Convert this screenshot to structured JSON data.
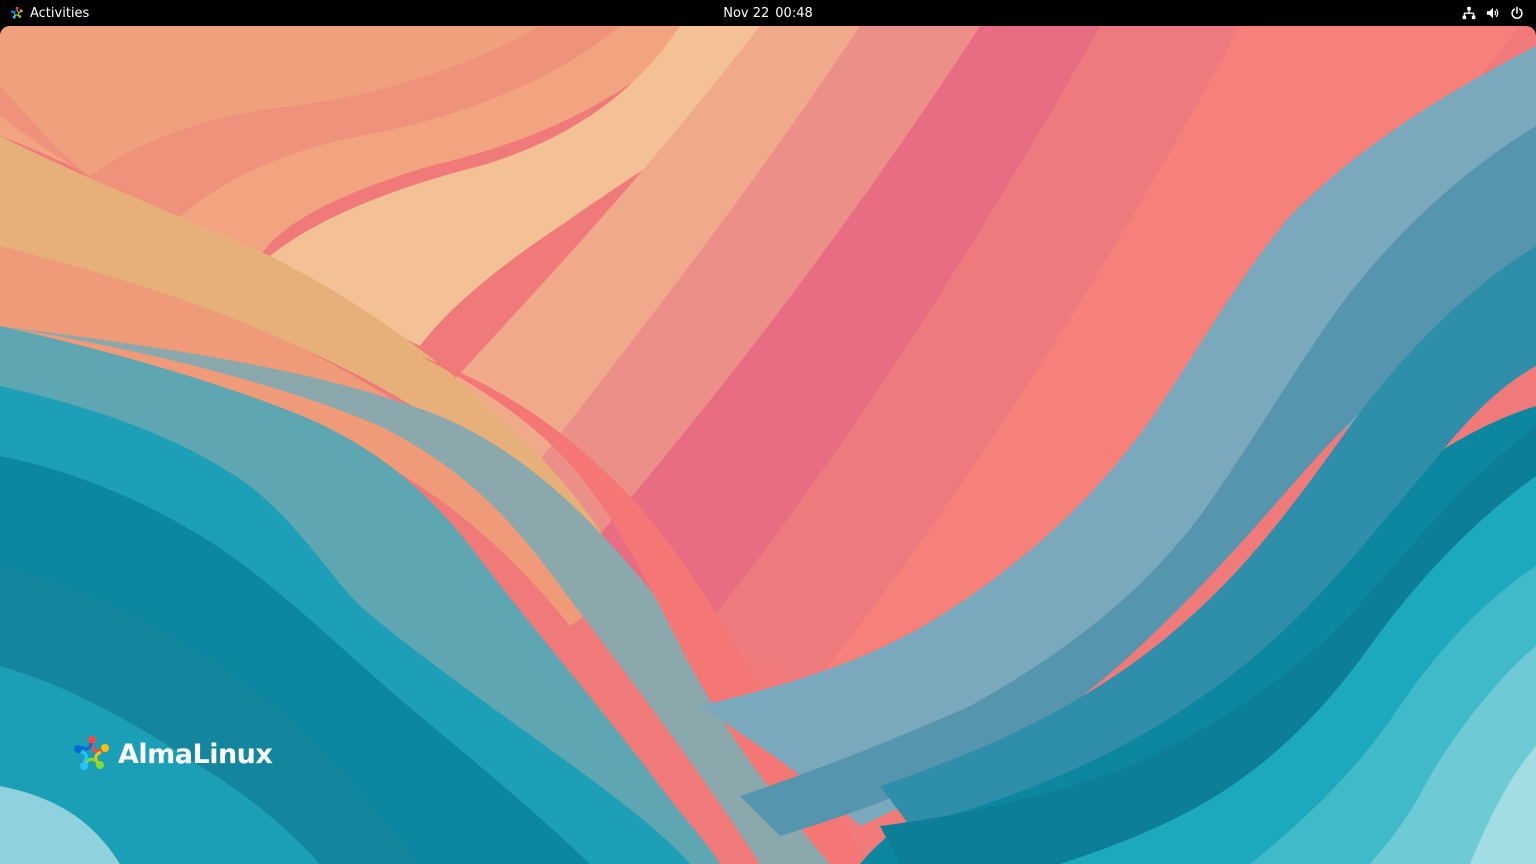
{
  "topbar": {
    "activities_label": "Activities",
    "date": "Nov 22",
    "time": "00:48",
    "tray": {
      "network_icon": "network-wired-icon",
      "volume_icon": "speaker-volume-icon",
      "power_icon": "power-icon"
    }
  },
  "desktop": {
    "brand_text": "AlmaLinux",
    "brand_icon": "almalinux-logo-icon",
    "colors": {
      "peach": "#f4b689",
      "salmon": "#ef8b7c",
      "coral": "#f47a78",
      "rose": "#e66a82",
      "slate": "#8aa8ae",
      "teal_dark": "#0b8199",
      "teal": "#1ea5bd",
      "aqua": "#6fcfda"
    }
  }
}
